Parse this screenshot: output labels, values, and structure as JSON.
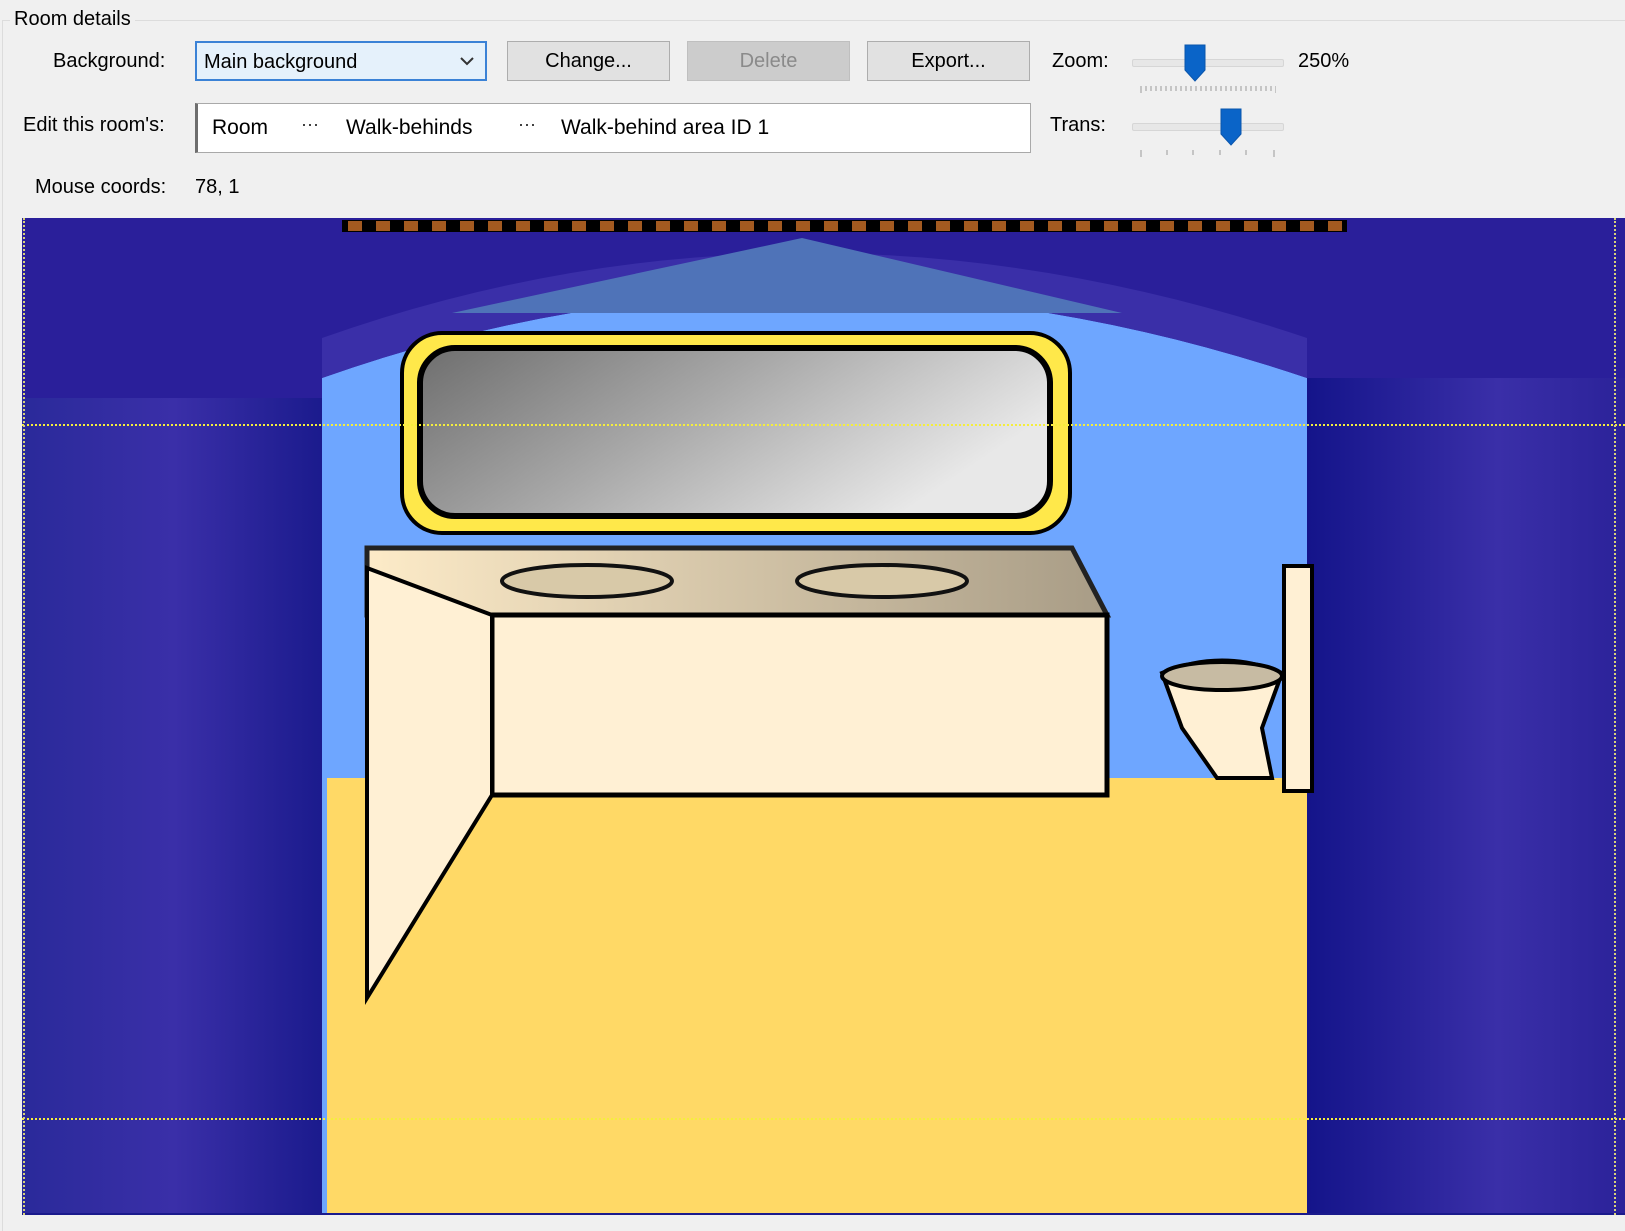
{
  "group": {
    "title": "Room details"
  },
  "background": {
    "label": "Background:",
    "selected": "Main background",
    "change_label": "Change...",
    "delete_label": "Delete",
    "export_label": "Export..."
  },
  "edit": {
    "label": "Edit this room's:",
    "crumbs": [
      "Room",
      "Walk-behinds",
      "Walk-behind area ID 1"
    ],
    "separator": "···"
  },
  "zoom": {
    "label": "Zoom:",
    "value_text": "250%",
    "level": 0.42
  },
  "trans": {
    "label": "Trans:",
    "level": 0.66
  },
  "mouse": {
    "label": "Mouse coords:",
    "value": "78, 1"
  },
  "colors": {
    "accent": "#0a64c8",
    "guide": "#f5ee3c",
    "curtain": "#2a1ca0",
    "floor": "#ffd966",
    "wall": "#6ea6ff"
  }
}
